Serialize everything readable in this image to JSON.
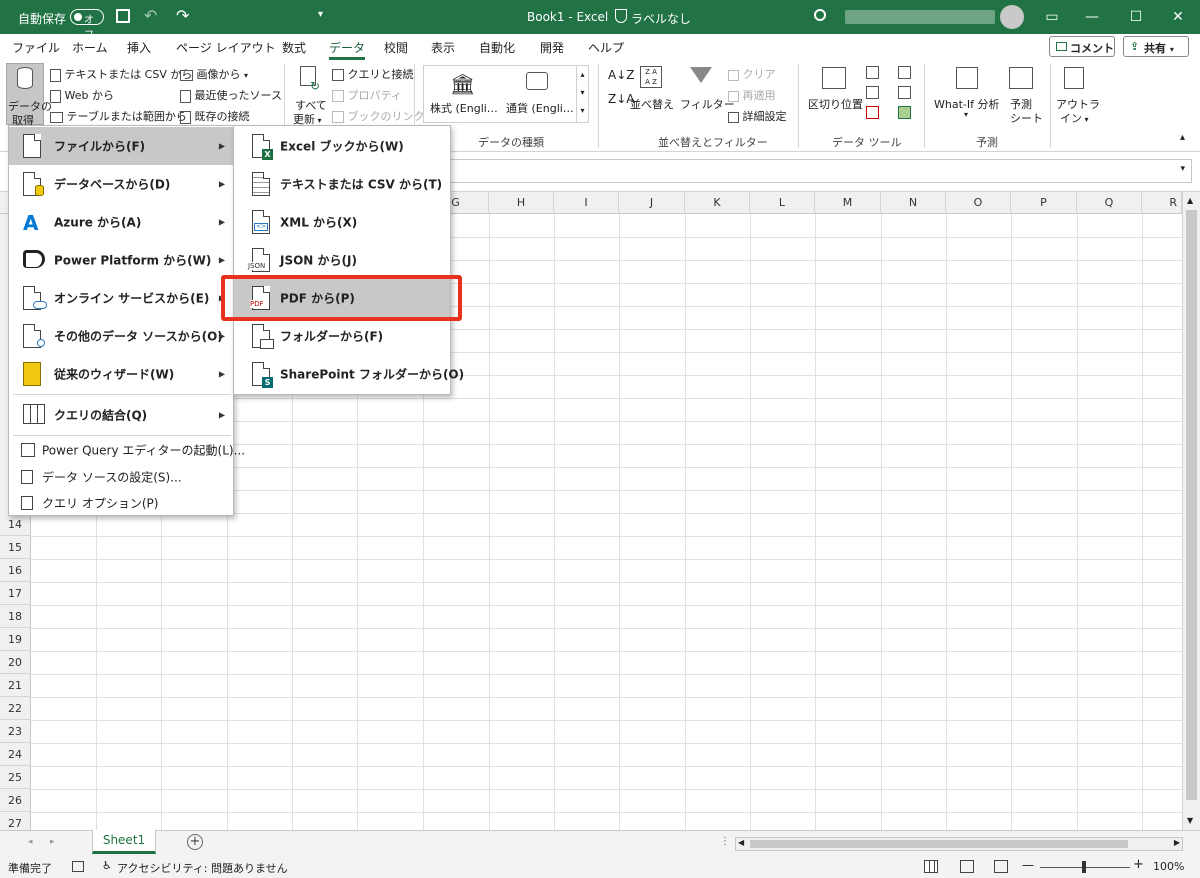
{
  "titlebar": {
    "autosave_label": "自動保存",
    "autosave_state": "オフ",
    "title": "Book1  -  Excel",
    "sensitivity": "ラベルなし",
    "accent": "#217346"
  },
  "tabs": [
    "ファイル",
    "ホーム",
    "挿入",
    "ページ レイアウト",
    "数式",
    "データ",
    "校閲",
    "表示",
    "自動化",
    "開発",
    "ヘルプ"
  ],
  "active_tab": "データ",
  "share": {
    "comment_label": "コメント",
    "share_label": "共有"
  },
  "ribbon": {
    "get_data": {
      "line1": "データの",
      "line2": "取得"
    },
    "get_transform": {
      "from_text_csv": "テキストまたは CSV から",
      "from_web": "Web から",
      "from_table": "テーブルまたは範囲から",
      "from_picture": "画像から",
      "recent_sources": "最近使ったソース",
      "existing_connections": "既存の接続"
    },
    "refresh": {
      "line1": "すべて",
      "line2": "更新"
    },
    "queries": {
      "queries_connections": "クエリと接続",
      "properties": "プロパティ",
      "edit_links": "ブックのリンク"
    },
    "data_types": {
      "stocks": "株式 (Engli…",
      "currencies": "通貨 (Engli…",
      "group_label": "データの種類"
    },
    "sort_filter": {
      "sort": "並べ替え",
      "filter": "フィルター",
      "clear": "クリア",
      "reapply": "再適用",
      "advanced": "詳細設定",
      "group_label": "並べ替えとフィルター"
    },
    "data_tools": {
      "text_to_columns": "区切り位置",
      "group_label": "データ ツール"
    },
    "forecast": {
      "what_if": "What-If 分析",
      "forecast_line1": "予測",
      "forecast_line2": "シート",
      "group_label": "予測"
    },
    "outline": {
      "line1": "アウトラ",
      "line2": "イン"
    }
  },
  "columns": [
    "G",
    "H",
    "I",
    "J",
    "K",
    "L",
    "M",
    "N",
    "O",
    "P",
    "Q",
    "R"
  ],
  "rows": [
    "14",
    "15",
    "16",
    "17",
    "18",
    "19",
    "20",
    "21",
    "22",
    "23",
    "24",
    "25",
    "26",
    "27"
  ],
  "get_data_menu": {
    "items": [
      {
        "label": "ファイルから(F)",
        "submenu": true
      },
      {
        "label": "データベースから(D)",
        "submenu": true
      },
      {
        "label": "Azure から(A)",
        "submenu": true
      },
      {
        "label": "Power Platform から(W)",
        "submenu": true
      },
      {
        "label": "オンライン サービスから(E)",
        "submenu": true
      },
      {
        "label": "その他のデータ ソースから(O)",
        "submenu": true
      },
      {
        "label": "従来のウィザード(W)",
        "submenu": true
      },
      {
        "label": "クエリの結合(Q)",
        "submenu": true
      }
    ],
    "footer": [
      {
        "label": "Power Query エディターの起動(L)..."
      },
      {
        "label": "データ ソースの設定(S)..."
      },
      {
        "label": "クエリ オプション(P)"
      }
    ]
  },
  "file_submenu": {
    "items": [
      {
        "label": "Excel ブックから(W)",
        "badge": "X",
        "badge_color": "#1d6f42"
      },
      {
        "label": "テキストまたは CSV から(T)",
        "badge": "",
        "badge_color": ""
      },
      {
        "label": "XML から(X)",
        "badge": "",
        "badge_color": ""
      },
      {
        "label": "JSON から(J)",
        "badge": "JSON",
        "badge_color": ""
      },
      {
        "label": "PDF から(P)",
        "badge": "PDF",
        "badge_color": ""
      },
      {
        "label": "フォルダーから(F)",
        "badge": "",
        "badge_color": ""
      },
      {
        "label": "SharePoint フォルダーから(O)",
        "badge": "S",
        "badge_color": "#036c70"
      }
    ],
    "highlighted_index": 4,
    "highlight_color": "#e8321e"
  },
  "sheetbar": {
    "tab": "Sheet1"
  },
  "statusbar": {
    "ready": "準備完了",
    "accessibility": "アクセシビリティ: 問題ありません",
    "zoom": "100%"
  }
}
